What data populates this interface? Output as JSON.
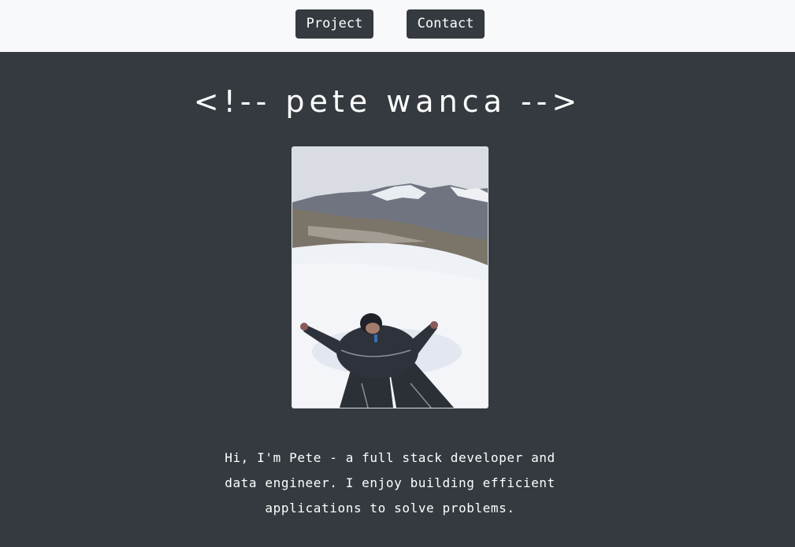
{
  "nav": {
    "project_label": "Project",
    "contact_label": "Contact"
  },
  "hero": {
    "title": "<!-- pete wanca -->",
    "photo_icon": "portrait-photo",
    "bio": "Hi, I'm Pete - a full stack developer and data engineer. I enjoy building efficient applications to solve problems."
  },
  "colors": {
    "page_background": "#343a40",
    "topbar_background": "#f8f9fa",
    "button_background": "#343a40",
    "text": "#ffffff"
  }
}
